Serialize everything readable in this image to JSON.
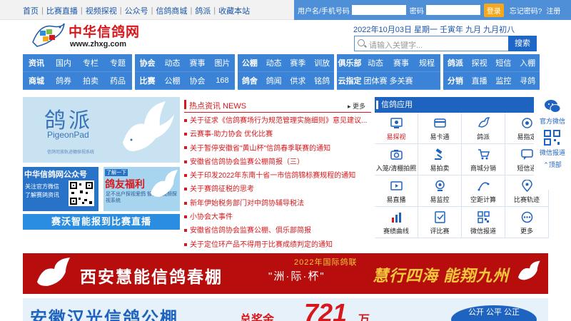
{
  "toplinks": [
    "首页",
    "比赛直播",
    "视频探视",
    "公众号",
    "信鸽商城",
    "鸽派",
    "收藏本站"
  ],
  "login": {
    "user_label": "用户名/手机号码",
    "pass_label": "密码",
    "login_btn": "登录",
    "forgot": "忘记密码?",
    "register": "注册"
  },
  "logo": {
    "name": "中华信鸽网",
    "url": "www.zhxg.com"
  },
  "date": "2022年10月03日 星期一 壬寅年 九月 九月初八",
  "search": {
    "placeholder": "请输入关键字...",
    "button": "搜索"
  },
  "nav": {
    "b1": {
      "r1": [
        "资讯",
        "国内",
        "专栏",
        "专题"
      ],
      "r2": [
        "商城",
        "鸽券",
        "拍卖",
        "药品"
      ]
    },
    "b2": {
      "r1": [
        "协会",
        "动态",
        "赛事",
        "图片"
      ],
      "r2": [
        "比赛",
        "公棚",
        "协会",
        "168"
      ]
    },
    "b3": {
      "r1": [
        "公棚",
        "动态",
        "赛季",
        "训放"
      ],
      "r2": [
        "鸽舍",
        "鸽闻",
        "供求",
        "铭鸽"
      ]
    },
    "b4": {
      "r1": [
        "俱乐部",
        "动态",
        "赛事",
        "规程"
      ],
      "r2": [
        "云指定",
        "团体赛",
        "多关赛"
      ]
    },
    "b5": {
      "r1": [
        "鸽派",
        "探视",
        "短信",
        "入棚"
      ],
      "r2": [
        "分销",
        "直播",
        "监控",
        "寻鸽"
      ]
    }
  },
  "pigeonpad": {
    "title": "鸽派",
    "subtitle": "PigeonPad",
    "caption": "信鸽司放轨迹棚探视系统"
  },
  "pub": {
    "title": "中华信鸽网公众号",
    "desc": "关注官方微信 了解赛鸽资讯"
  },
  "fuli": {
    "tag": "了解一下",
    "title": "鸽友福利",
    "desc": "足不出户探视爱鸽 智能型视频探视系统"
  },
  "scan": "赛沃智能报到比赛直播",
  "news": {
    "title": "热点资讯 NEWS",
    "more": "更多",
    "items": [
      "关于征求《信鸽赛场行为规范管理实施细则》意见建议...",
      "云赛事-助力协会 优化比赛",
      "关于暂停安徽省\"黄山杯\"信鸽春季联赛的通知",
      "安徽省信鸽协会监赛公棚简报（三）",
      "关于印发2022年东南十省一市信鸽锦标赛规程的通知",
      "关于赛鸽征税的思考",
      "新年伊始税务部门对中鸽协辅导税法",
      "小协会大事件",
      "安徽省信鸽协会监赛公棚、俱乐部简报",
      "关于定位环产品不得用于比赛成绩判定的通知"
    ]
  },
  "apps": {
    "title": "信鸽应用",
    "more": "更多",
    "items": [
      {
        "label": "易探视",
        "icon": "eye-icon",
        "red": true
      },
      {
        "label": "易卡通",
        "icon": "card-icon",
        "red": false
      },
      {
        "label": "鸽派",
        "icon": "pigeon-icon",
        "red": false
      },
      {
        "label": "易指定",
        "icon": "target-icon",
        "red": false
      },
      {
        "label": "入笼/清棚拍照",
        "icon": "camera-icon",
        "red": false
      },
      {
        "label": "易拍卖",
        "icon": "gavel-icon",
        "red": false
      },
      {
        "label": "商城分销",
        "icon": "cart-icon",
        "red": false
      },
      {
        "label": "短信通",
        "icon": "message-icon",
        "red": false
      },
      {
        "label": "易直播",
        "icon": "video-icon",
        "red": false
      },
      {
        "label": "易监控",
        "icon": "monitor-icon",
        "red": false
      },
      {
        "label": "空距计算",
        "icon": "distance-icon",
        "red": false
      },
      {
        "label": "比赛轨迹",
        "icon": "location-icon",
        "red": false
      },
      {
        "label": "赛绩曲线",
        "icon": "chart-icon",
        "red": false
      },
      {
        "label": "评比赛",
        "icon": "rating-icon",
        "red": false
      },
      {
        "label": "微信报道",
        "icon": "qr-icon",
        "red": false
      },
      {
        "label": "更多",
        "icon": "more-icon",
        "red": false
      }
    ]
  },
  "side": {
    "wechat": "官方微信",
    "report": "微信报道",
    "top": "顶部"
  },
  "ad1": {
    "year": "2022年国际鸽联",
    "title": "西安慧能信鸽春棚",
    "cup": "\"洲·际·杯\"",
    "slogan": "慧行四海 能翔九州"
  },
  "ad2": {
    "title": "安徽汉光信鸽公棚",
    "prize_label": "总奖金",
    "prize_value": "721",
    "prize_unit": "万",
    "right": "公开 公平 公正"
  },
  "colors": {
    "brand_blue": "#3b83d6",
    "brand_red": "#d6181c",
    "header_blue": "#1e63c0"
  }
}
